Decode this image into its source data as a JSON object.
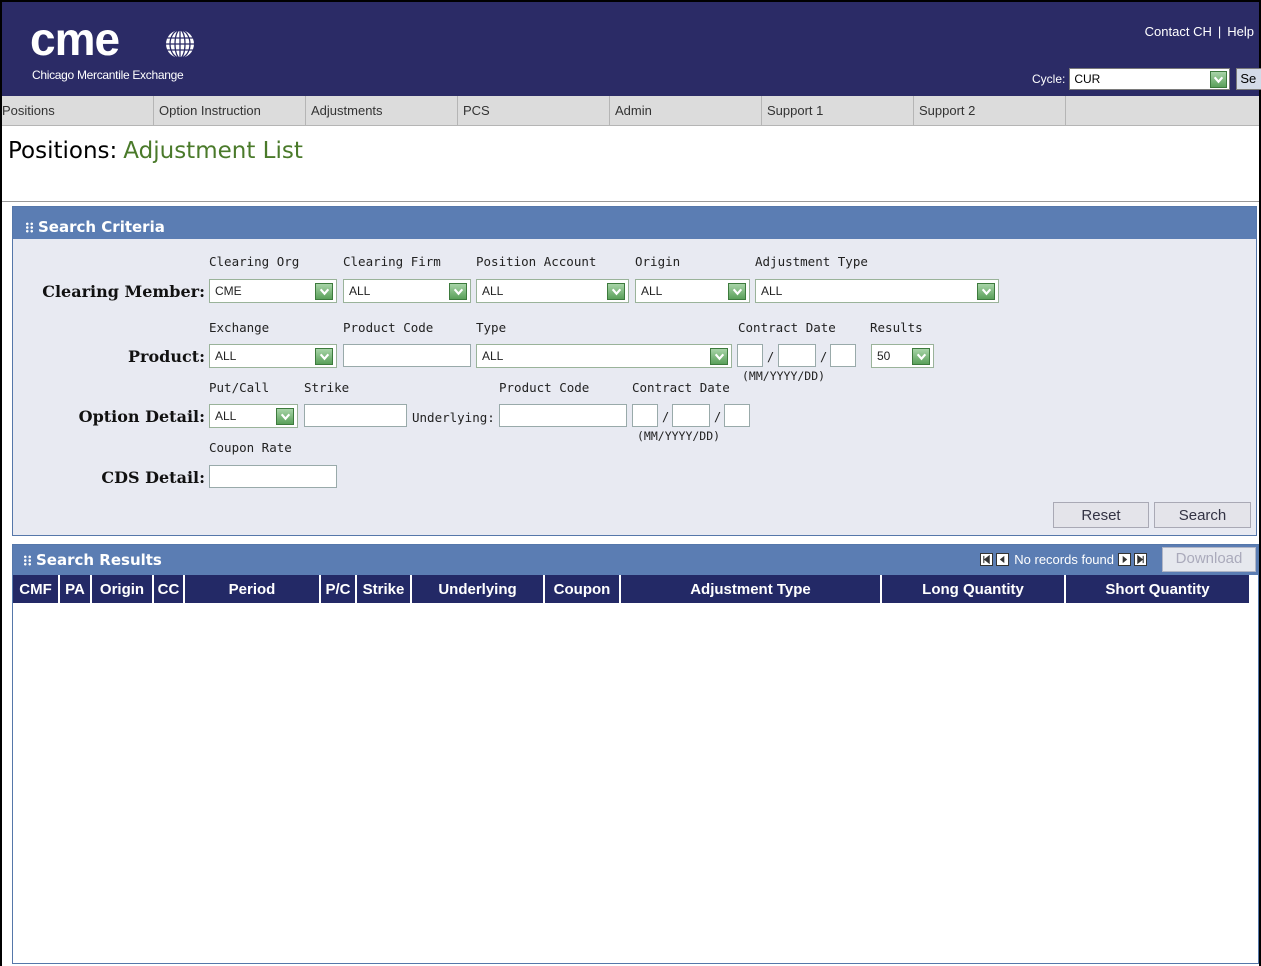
{
  "header": {
    "logo_text": "cme",
    "logo_subtitle": "Chicago Mercantile Exchange",
    "contact_link": "Contact CH",
    "separator": "|",
    "help_link": "Help",
    "cycle_label": "Cycle:",
    "cycle_value": "CUR",
    "cycle_button": "Se",
    "colors": {
      "header_bg": "#2b2b66",
      "accent": "#4a7a2a"
    }
  },
  "nav": {
    "items": [
      {
        "label": "Positions"
      },
      {
        "label": "Option Instruction"
      },
      {
        "label": "Adjustments"
      },
      {
        "label": "PCS"
      },
      {
        "label": "Admin"
      },
      {
        "label": "Support 1"
      },
      {
        "label": "Support 2"
      }
    ]
  },
  "page": {
    "title_prefix": "Positions:",
    "title": "Adjustment List"
  },
  "search_criteria": {
    "heading": "Search Criteria",
    "clearing_member": {
      "label": "Clearing Member:",
      "clearing_org_label": "Clearing Org",
      "clearing_org_value": "CME",
      "clearing_firm_label": "Clearing Firm",
      "clearing_firm_value": "ALL",
      "position_account_label": "Position Account",
      "position_account_value": "ALL",
      "origin_label": "Origin",
      "origin_value": "ALL",
      "adjustment_type_label": "Adjustment Type",
      "adjustment_type_value": "ALL"
    },
    "product": {
      "label": "Product:",
      "exchange_label": "Exchange",
      "exchange_value": "ALL",
      "product_code_label": "Product Code",
      "product_code_value": "",
      "type_label": "Type",
      "type_value": "ALL",
      "contract_date_label": "Contract Date",
      "date_format": "(MM/YYYY/DD)",
      "results_label": "Results",
      "results_value": "50"
    },
    "option_detail": {
      "label": "Option Detail:",
      "put_call_label": "Put/Call",
      "put_call_value": "ALL",
      "strike_label": "Strike",
      "underlying_label": "Underlying:",
      "product_code_label": "Product Code",
      "contract_date_label": "Contract Date",
      "date_format": "(MM/YYYY/DD)"
    },
    "cds_detail": {
      "label": "CDS Detail:",
      "coupon_rate_label": "Coupon Rate"
    },
    "slash": "/",
    "reset_button": "Reset",
    "search_button": "Search"
  },
  "search_results": {
    "heading": "Search Results",
    "status": "No records found",
    "download_button": "Download",
    "columns": [
      "CMF",
      "PA",
      "Origin",
      "CC",
      "Period",
      "P/C",
      "Strike",
      "Underlying",
      "Coupon",
      "Adjustment Type",
      "Long Quantity",
      "Short Quantity"
    ],
    "rows": []
  }
}
